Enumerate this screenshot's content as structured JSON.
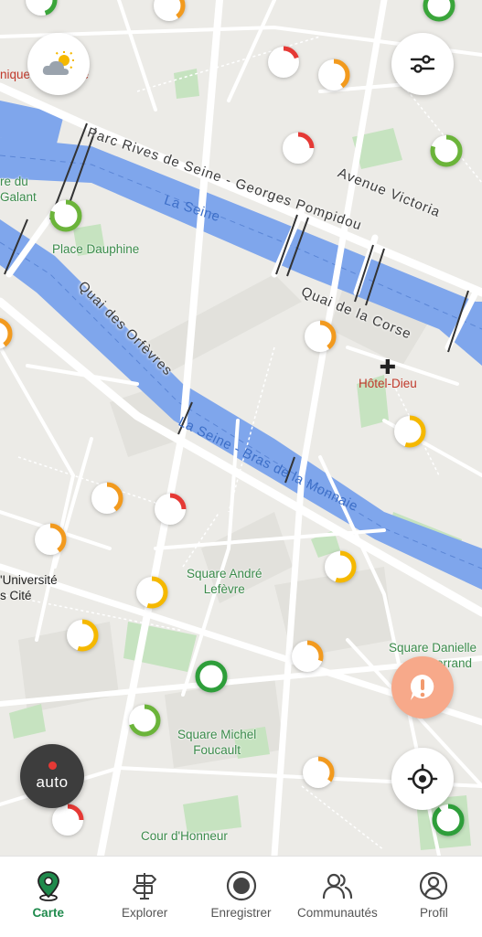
{
  "map": {
    "streets": [
      {
        "id": "parc-rives",
        "text": "Parc Rives de Seine - Georges Pompidou"
      },
      {
        "id": "avenue-victoria",
        "text": "Avenue Victoria"
      },
      {
        "id": "quai-corse",
        "text": "Quai de la Corse"
      },
      {
        "id": "quai-orfevres",
        "text": "Quai des Orfèvres"
      }
    ],
    "water_labels": [
      {
        "id": "la-seine",
        "text": "La Seine"
      },
      {
        "id": "bras-monnaie",
        "text": "La Seine - Bras de la Monnaie"
      }
    ],
    "places": {
      "place_dauphine": "Place Dauphine",
      "hotel_dieu": "Hôtel-Dieu",
      "square_andre": [
        "Square André",
        "Lefèvre"
      ],
      "square_michel": [
        "Square Michel",
        "Foucault"
      ],
      "cour_honneur": "Cour d'Honneur",
      "square_danielle": [
        "Square Danielle",
        "errand"
      ],
      "vert_galant": [
        "re du",
        "Galant"
      ],
      "universite": [
        "'Université",
        "s Cité"
      ],
      "top_left_fragment": "nique",
      "top_left_fragment2": "re"
    },
    "markers": [
      {
        "color": "#3aa53a",
        "fill": 0.45
      },
      {
        "color": "#f29a1e",
        "fill": 0.4
      },
      {
        "color": "#3aa53a",
        "fill": 0.85
      },
      {
        "color": "#e53935",
        "fill": 0.2
      },
      {
        "color": "#f29a1e",
        "fill": 0.4
      },
      {
        "color": "#e53935",
        "fill": 0.25
      },
      {
        "color": "#6bb43a",
        "fill": 0.8
      },
      {
        "color": "#6bb43a",
        "fill": 0.8
      },
      {
        "color": "#f29a1e",
        "fill": 0.4
      },
      {
        "color": "#f5b800",
        "fill": 0.55
      },
      {
        "color": "#f29a1e",
        "fill": 0.4
      },
      {
        "color": "#e53935",
        "fill": 0.25
      },
      {
        "color": "#f29a1e",
        "fill": 0.4
      },
      {
        "color": "#f5b800",
        "fill": 0.55
      },
      {
        "color": "#f5b800",
        "fill": 0.55
      },
      {
        "color": "#f5b800",
        "fill": 0.55
      },
      {
        "color": "#f29a1e",
        "fill": 0.3
      },
      {
        "color": "#2e9e3a",
        "fill": 1.0
      },
      {
        "color": "#6bb43a",
        "fill": 0.7
      },
      {
        "color": "#f29a1e",
        "fill": 0.35
      },
      {
        "color": "#e53935",
        "fill": 0.25
      },
      {
        "color": "#2e9e3a",
        "fill": 0.9
      },
      {
        "color": "#f29a1e",
        "fill": 0.4
      }
    ]
  },
  "controls": {
    "weather_icon": "partly-sunny-icon",
    "filter_icon": "sliders-icon",
    "alert_icon": "exclamation-icon",
    "locate_icon": "crosshair-icon",
    "auto_label": "auto"
  },
  "nav": {
    "tabs": [
      {
        "id": "carte",
        "label": "Carte",
        "icon": "map-pin-icon",
        "active": true
      },
      {
        "id": "explorer",
        "label": "Explorer",
        "icon": "signpost-icon",
        "active": false
      },
      {
        "id": "enregistrer",
        "label": "Enregistrer",
        "icon": "record-icon",
        "active": false
      },
      {
        "id": "communautes",
        "label": "Communautés",
        "icon": "people-icon",
        "active": false
      },
      {
        "id": "profil",
        "label": "Profil",
        "icon": "user-icon",
        "active": false
      }
    ]
  },
  "colors": {
    "active_tab": "#1f8a4c",
    "river": "#7fa6ec",
    "alert": "#f7a98a",
    "auto_button": "#3d3d3d"
  }
}
